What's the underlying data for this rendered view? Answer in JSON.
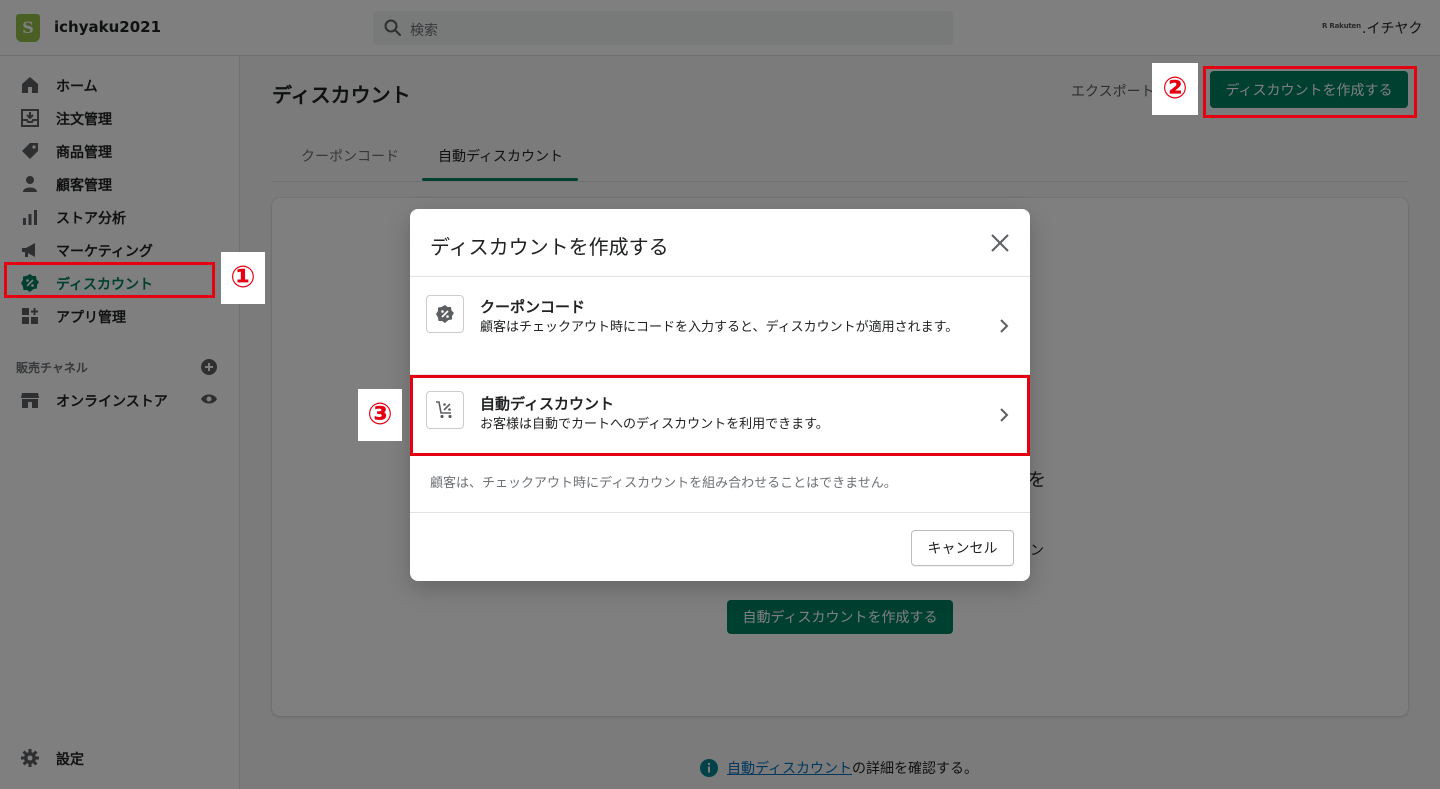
{
  "topbar": {
    "store_name": "ichyaku2021",
    "logo_glyph": "S",
    "search_placeholder": "検索",
    "user_badge": "R Rakuten",
    "user_name": ".イチヤク"
  },
  "sidebar": {
    "items": [
      {
        "label": "ホーム",
        "icon": "home-icon"
      },
      {
        "label": "注文管理",
        "icon": "orders-icon"
      },
      {
        "label": "商品管理",
        "icon": "products-icon"
      },
      {
        "label": "顧客管理",
        "icon": "customers-icon"
      },
      {
        "label": "ストア分析",
        "icon": "analytics-icon"
      },
      {
        "label": "マーケティング",
        "icon": "marketing-icon"
      },
      {
        "label": "ディスカウント",
        "icon": "discount-icon",
        "active": true
      },
      {
        "label": "アプリ管理",
        "icon": "apps-icon"
      }
    ],
    "sales_channels_title": "販売チャネル",
    "online_store_label": "オンラインストア",
    "settings_label": "設定"
  },
  "main": {
    "title": "ディスカウント",
    "export_label": "エクスポート",
    "create_button": "ディスカウントを作成する",
    "tabs": [
      {
        "label": "クーポンコード"
      },
      {
        "label": "自動ディスカウント",
        "active": true
      }
    ],
    "card_button": "自動ディスカウントを作成する",
    "card_hint_1": "を",
    "card_hint_2": "ン",
    "footer_link": "自動ディスカウント",
    "footer_text": "の詳細を確認する。"
  },
  "modal": {
    "title": "ディスカウントを作成する",
    "options": [
      {
        "title": "クーポンコード",
        "description": "顧客はチェックアウト時にコードを入力すると、ディスカウントが適用されます。",
        "icon": "discount-code-icon"
      },
      {
        "title": "自動ディスカウント",
        "description": "お客様は自動でカートへのディスカウントを利用できます。",
        "icon": "cart-discount-icon"
      }
    ],
    "note": "顧客は、チェックアウト時にディスカウントを組み合わせることはできません。",
    "cancel_label": "キャンセル"
  },
  "annotations": {
    "one": "①",
    "two": "②",
    "three": "③"
  },
  "colors": {
    "accent": "#008060",
    "active_text": "#007f5f",
    "annotation_red": "#e50012",
    "link": "#006fbb"
  }
}
